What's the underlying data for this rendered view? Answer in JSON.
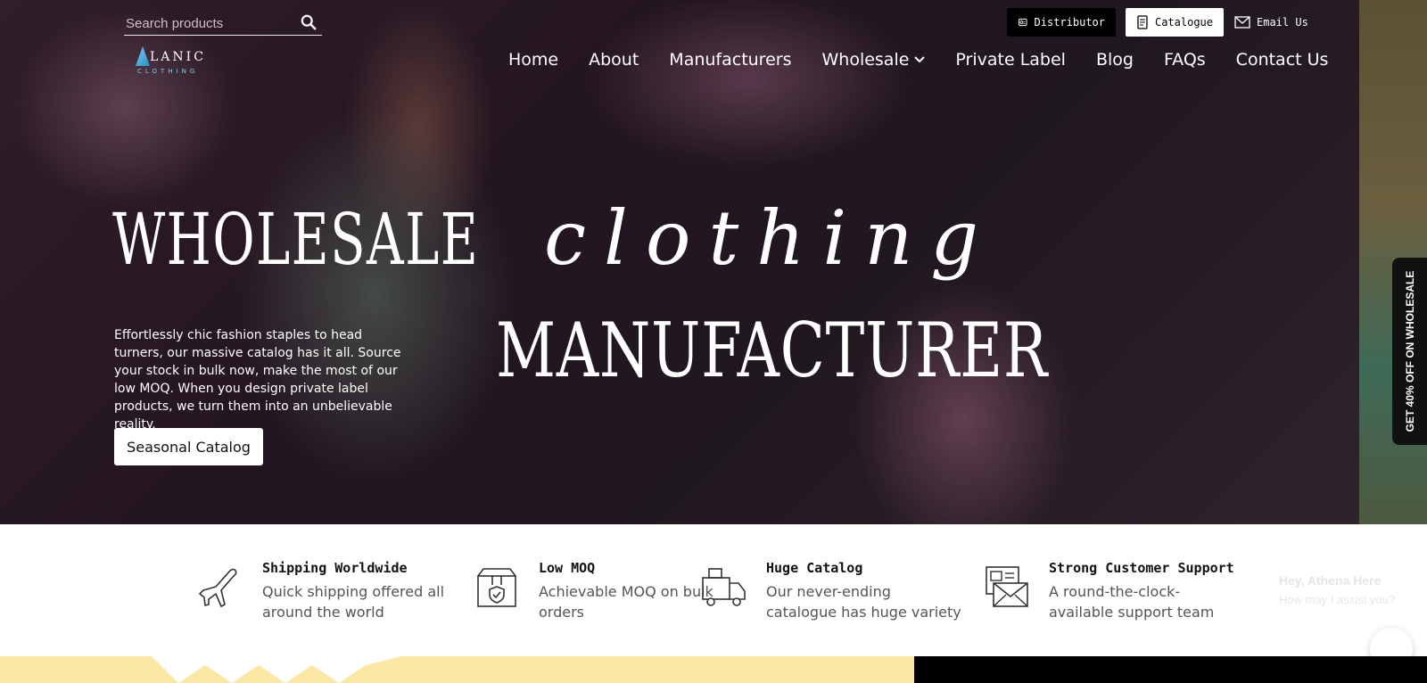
{
  "search": {
    "placeholder": "Search products"
  },
  "logo": {
    "name": "LANIC",
    "sub": "CLOTHING"
  },
  "top_buttons": {
    "distributor": "Distributor",
    "catalogue": "Catalogue",
    "email": "Email Us"
  },
  "nav": {
    "home": "Home",
    "about": "About",
    "manufacturers": "Manufacturers",
    "wholesale": "Wholesale",
    "private_label": "Private Label",
    "blog": "Blog",
    "faqs": "FAQs",
    "contact": "Contact Us"
  },
  "hero": {
    "line1": "WHOLESALE",
    "line1_italic": "clothing",
    "line2": "MANUFACTURER",
    "intro": "Effortlessly chic fashion staples to head turners, our massive catalog has it all. Source your stock in bulk now, make the most of our low MOQ. When you design private label products, we turn them into an unbelievable reality.",
    "cta": "Seasonal Catalog"
  },
  "side_tab": {
    "text": "GET 40% OFF ON WHOLESALE"
  },
  "features": [
    {
      "icon": "airplane-icon",
      "title": "Shipping Worldwide",
      "desc": "Quick shipping offered all around the world"
    },
    {
      "icon": "box-shield-icon",
      "title": "Low MOQ",
      "desc": "Achievable MOQ on bulk orders"
    },
    {
      "icon": "delivery-truck-icon",
      "title": "Huge Catalog",
      "desc": "Our never-ending catalogue has huge variety"
    },
    {
      "icon": "envelope-support-icon",
      "title": "Strong Customer Support",
      "desc": "A round-the-clock- available support team"
    }
  ],
  "chat": {
    "greeting": "Hey, Athena Here",
    "prompt": "How may I assist you?"
  },
  "colors": {
    "hero_dark": "#2a1a26",
    "bottom_yellow": "#fce8a3",
    "online_green": "#1db954"
  }
}
